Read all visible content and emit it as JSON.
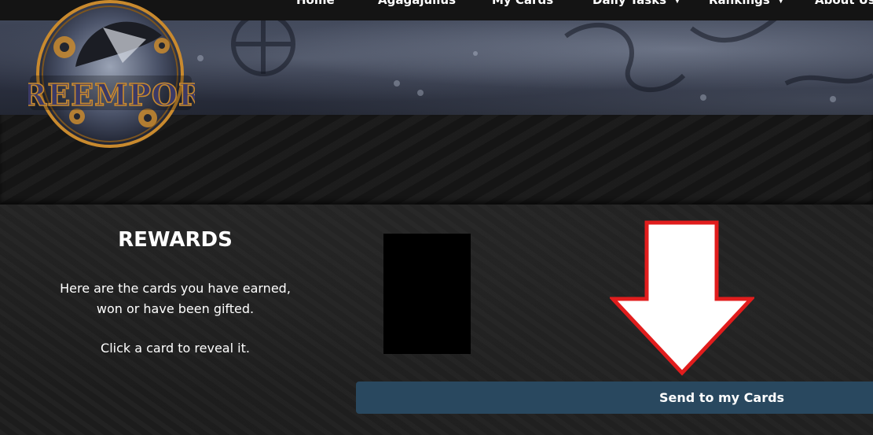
{
  "header": {
    "logo_text": "DREEMPORT",
    "nav": [
      {
        "label": "Home",
        "dropdown": false
      },
      {
        "label": "Agagajulius",
        "dropdown": false
      },
      {
        "label": "My Cards",
        "dropdown": false
      },
      {
        "label": "Daily Tasks",
        "dropdown": true
      },
      {
        "label": "Rankings",
        "dropdown": true
      },
      {
        "label": "About Us",
        "dropdown": false
      }
    ]
  },
  "rewards": {
    "title": "REWARDS",
    "description_line1": "Here are the cards you have earned,",
    "description_line2": "won or have been gifted.",
    "instruction": "Click a card to reveal it."
  },
  "actions": {
    "send_label": "Send to my Cards"
  },
  "annotation": {
    "arrow_icon": "down-arrow-icon",
    "arrow_fill": "#ffffff",
    "arrow_outline": "#e11d1d"
  },
  "colors": {
    "button_bg": "#29485f",
    "card_back": "#000000"
  }
}
